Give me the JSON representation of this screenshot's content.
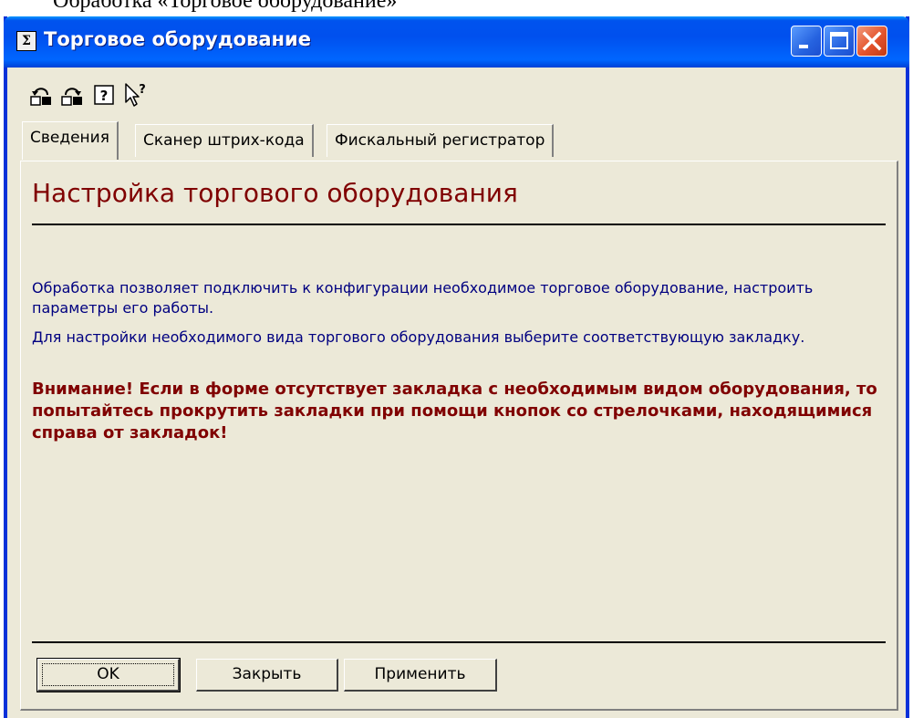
{
  "document": {
    "caption": "Обработка «Торговое оборудование»"
  },
  "window": {
    "title": "Торговое оборудование",
    "app_icon": "sigma-icon",
    "controls": [
      "minimize-icon",
      "maximize-icon",
      "close-icon"
    ]
  },
  "toolbar": {
    "buttons": [
      {
        "name": "restore-values-icon"
      },
      {
        "name": "save-values-icon"
      },
      {
        "name": "help-icon"
      },
      {
        "name": "context-help-icon"
      }
    ]
  },
  "tabs": [
    {
      "label": "Сведения",
      "active": true
    },
    {
      "label": "Сканер штрих-кода",
      "active": false
    },
    {
      "label": "Фискальный регистратор",
      "active": false
    }
  ],
  "content": {
    "heading": "Настройка торгового оборудования",
    "paragraph1": "Обработка позволяет подключить к конфигурации необходимое торговое оборудование, настроить параметры его работы.",
    "paragraph2": "Для настройки необходимого вида торгового оборудования выберите соответствующую закладку.",
    "warning": "Внимание! Если в форме отсутствует закладка с необходимым видом оборудования, то попытайтесь прокрутить закладки при помощи кнопок со стрелочками, находящимися справа от закладок!"
  },
  "buttons": {
    "ok": "OK",
    "close": "Закрыть",
    "apply": "Применить"
  },
  "colors": {
    "titlebar": "#0054e3",
    "window_bg": "#ece9d8",
    "heading": "#800000",
    "info_text": "#000080",
    "warning_text": "#800000"
  }
}
